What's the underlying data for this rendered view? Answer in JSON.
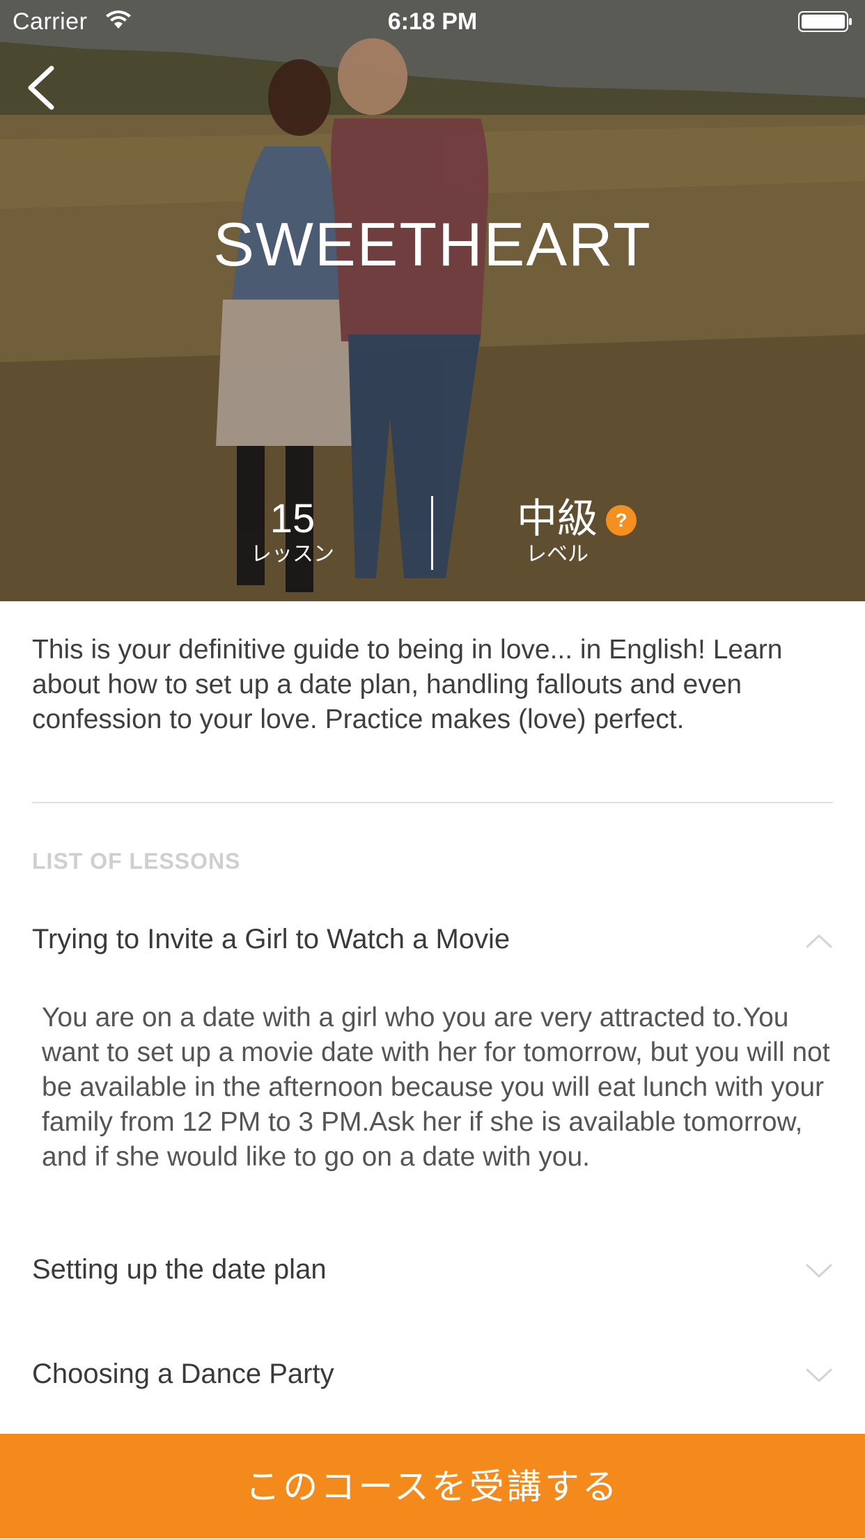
{
  "status_bar": {
    "carrier": "Carrier",
    "time": "6:18 PM"
  },
  "hero": {
    "title": "SWEETHEART",
    "lessons_count": "15",
    "lessons_label": "レッスン",
    "level_value": "中級",
    "level_label": "レベル",
    "help_symbol": "?"
  },
  "course": {
    "description": "This is your definitive guide to being in love... in English! Learn about how to set up a date plan, handling fallouts and even confession to your love. Practice makes (love) perfect.",
    "section_header": "LIST OF LESSONS",
    "lessons": [
      {
        "title": "Trying to Invite a Girl to Watch a Movie",
        "expanded": true,
        "body": "You are on a date with a girl who you are very attracted to.You want to set up a movie date with her for tomorrow, but you will not be available in the afternoon because you will eat lunch with your family from 12 PM to 3 PM.Ask her if she is available tomorrow, and if she would like to go on a date with you."
      },
      {
        "title": "Setting up the date plan",
        "expanded": false
      },
      {
        "title": "Choosing a Dance Party",
        "expanded": false
      }
    ]
  },
  "cta": {
    "label": "このコースを受講する"
  },
  "colors": {
    "accent": "#f48a1c",
    "help_badge": "#f39020",
    "text_primary": "#3a3a3a",
    "section_header": "#cfcfcf"
  },
  "icons": [
    "back-chevron-icon",
    "wifi-icon",
    "battery-icon",
    "help-icon",
    "chevron-up-icon",
    "chevron-down-icon"
  ]
}
